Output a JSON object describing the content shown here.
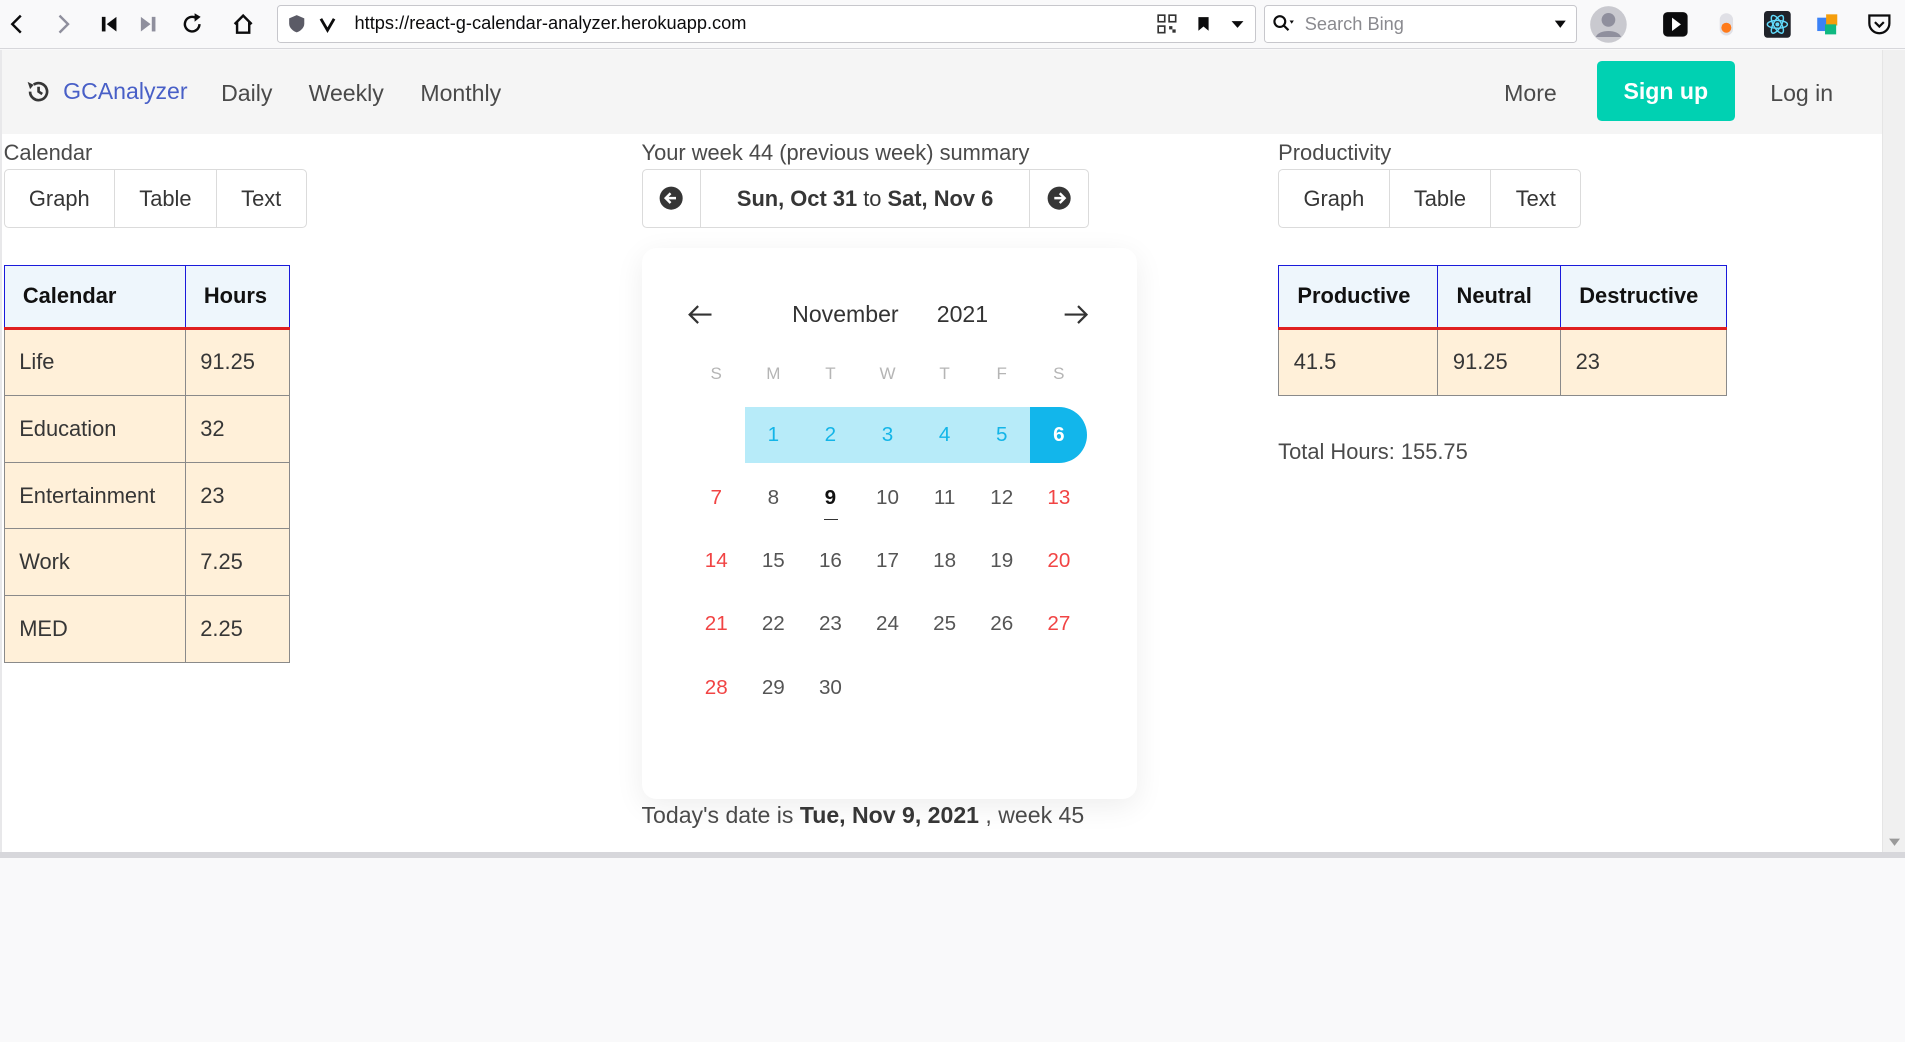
{
  "browser": {
    "url": "https://react-g-calendar-analyzer.herokuapp.com",
    "search_placeholder": "Search Bing"
  },
  "navbar": {
    "brand": "GCAnalyzer",
    "items": [
      "Daily",
      "Weekly",
      "Monthly"
    ],
    "more": "More",
    "signup": "Sign up",
    "login": "Log in"
  },
  "calendar_panel": {
    "label": "Calendar",
    "tabs": [
      "Graph",
      "Table",
      "Text"
    ],
    "headers": [
      "Calendar",
      "Hours"
    ],
    "rows": [
      [
        "Life",
        "91.25"
      ],
      [
        "Education",
        "32"
      ],
      [
        "Entertainment",
        "23"
      ],
      [
        "Work",
        "7.25"
      ],
      [
        "MED",
        "2.25"
      ]
    ]
  },
  "summary": {
    "label": "Your week 44 (previous week) summary",
    "start": "Sun, Oct 31",
    "to": " to ",
    "end": "Sat, Nov 6"
  },
  "datepicker": {
    "month": "November",
    "year": "2021",
    "weekdays": [
      "S",
      "M",
      "T",
      "W",
      "T",
      "F",
      "S"
    ],
    "weeks": [
      [
        "",
        "1",
        "2",
        "3",
        "4",
        "5",
        "6"
      ],
      [
        "7",
        "8",
        "9",
        "10",
        "11",
        "12",
        "13"
      ],
      [
        "14",
        "15",
        "16",
        "17",
        "18",
        "19",
        "20"
      ],
      [
        "21",
        "22",
        "23",
        "24",
        "25",
        "26",
        "27"
      ],
      [
        "28",
        "29",
        "30",
        "",
        "",
        "",
        ""
      ]
    ],
    "selected_range": [
      "1",
      "6"
    ],
    "today": "9"
  },
  "productivity_panel": {
    "label": "Productivity",
    "tabs": [
      "Graph",
      "Table",
      "Text"
    ],
    "headers": [
      "Productive",
      "Neutral",
      "Destructive"
    ],
    "rows": [
      [
        "41.5",
        "91.25",
        "23"
      ]
    ],
    "total": "Total Hours: 155.75"
  },
  "footer": {
    "prefix": "Today's date is ",
    "date": "Tue, Nov 9, 2021",
    "suffix": " , week 45"
  },
  "colors": {
    "brand": "#485fc7",
    "signup": "#00d1b2",
    "range_bg": "#b7ebf9",
    "range_end": "#12b6eb",
    "weekend": "#f14444"
  }
}
